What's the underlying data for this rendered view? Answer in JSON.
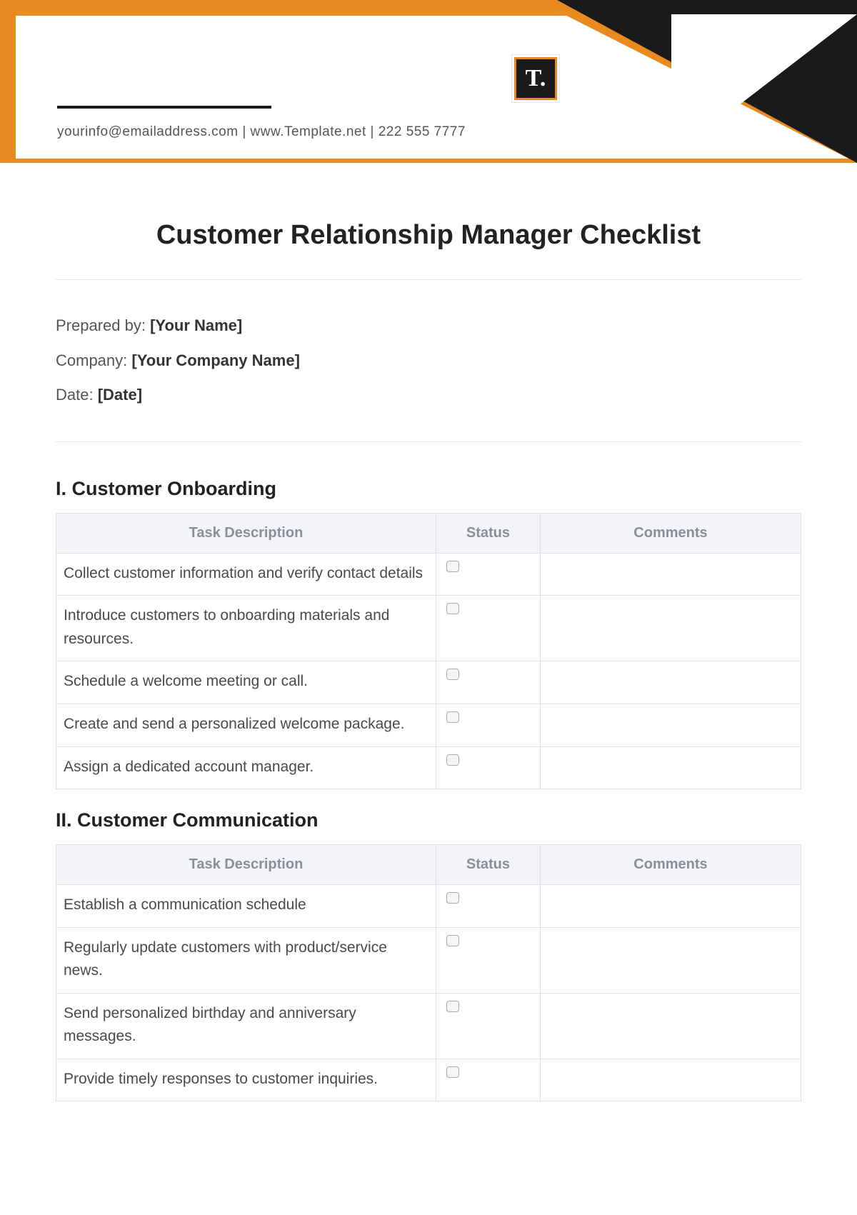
{
  "header": {
    "contact_line": "yourinfo@emailaddress.com  |  www.Template.net  |  222 555 7777",
    "logo_text": "T."
  },
  "title": "Customer Relationship Manager Checklist",
  "meta": {
    "prepared_by_label": "Prepared by: ",
    "prepared_by_value": "[Your Name]",
    "company_label": "Company: ",
    "company_value": "[Your Company Name]",
    "date_label": "Date: ",
    "date_value": "[Date]"
  },
  "columns": {
    "task": "Task Description",
    "status": "Status",
    "comments": "Comments"
  },
  "sections": [
    {
      "heading": "I. Customer Onboarding",
      "rows": [
        {
          "task": "Collect customer information and verify contact details",
          "comments": ""
        },
        {
          "task": "Introduce customers to onboarding materials and resources.",
          "comments": ""
        },
        {
          "task": "Schedule a welcome meeting or call.",
          "comments": ""
        },
        {
          "task": "Create and send a personalized welcome package.",
          "comments": ""
        },
        {
          "task": "Assign a dedicated account manager.",
          "comments": ""
        }
      ]
    },
    {
      "heading": "II. Customer Communication",
      "rows": [
        {
          "task": "Establish a communication schedule",
          "comments": ""
        },
        {
          "task": "Regularly update customers with product/service news.",
          "comments": ""
        },
        {
          "task": "Send personalized birthday and anniversary messages.",
          "comments": ""
        },
        {
          "task": "Provide timely responses to customer inquiries.",
          "comments": ""
        }
      ]
    }
  ]
}
